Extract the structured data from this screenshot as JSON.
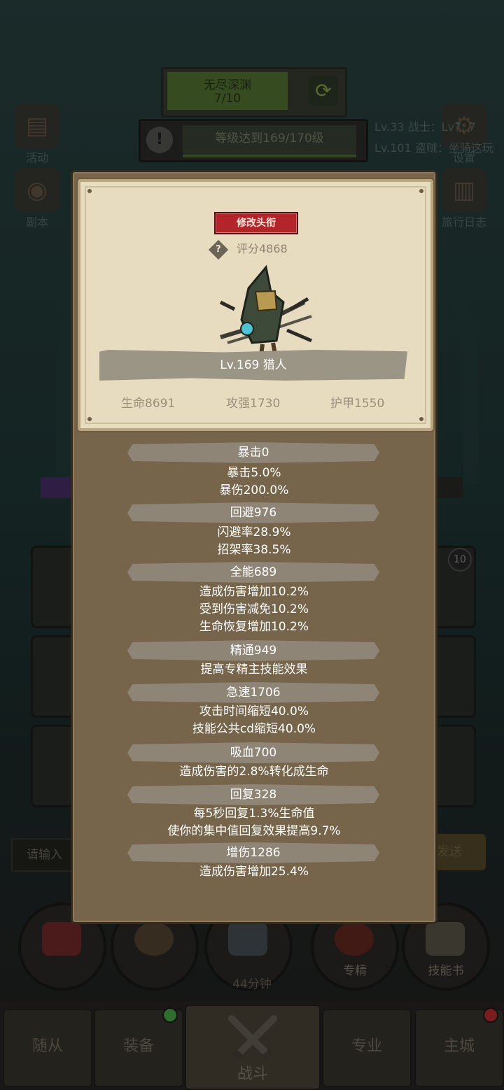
{
  "background": {
    "top_bar": {
      "title": "无尽深渊",
      "progress": "7/10",
      "cycle_icon": "refresh-icon"
    },
    "quest": {
      "text": "等级达到169/170级",
      "warn_icon": "!"
    },
    "left_buttons": [
      {
        "label": "活动"
      },
      {
        "label": "副本"
      }
    ],
    "right_buttons": [
      {
        "label": "设置"
      },
      {
        "label": "旅行日志"
      }
    ],
    "chat": [
      "Lv.33 战士：Lv7, 7",
      "Lv.101 盗贼：坐骑这玩"
    ],
    "badge": "10",
    "input_placeholder": "请输入",
    "send_label": "发送",
    "circles": [
      {
        "label": ""
      },
      {
        "label": ""
      },
      {
        "label": ""
      },
      {
        "label": "专精"
      },
      {
        "label": "技能书"
      }
    ],
    "timer": "44分钟",
    "nav": [
      {
        "label": "随从"
      },
      {
        "label": "装备"
      },
      {
        "label": "战斗"
      },
      {
        "label": "专业"
      },
      {
        "label": "主城"
      }
    ],
    "colors": {
      "green_dot": "#4cae4c",
      "red_dot": "#c62f2f"
    }
  },
  "modal": {
    "title_button": "修改头衔",
    "score": "评分4868",
    "score_icon": "?",
    "character": "Lv.169 猎人",
    "stats": {
      "hp": "生命8691",
      "atk": "攻强1730",
      "armor": "护甲1550"
    },
    "sections": [
      {
        "header": "暴击0",
        "lines": [
          "暴击5.0%",
          "暴伤200.0%"
        ]
      },
      {
        "header": "回避976",
        "lines": [
          "闪避率28.9%",
          "招架率38.5%"
        ]
      },
      {
        "header": "全能689",
        "lines": [
          "造成伤害增加10.2%",
          "受到伤害减免10.2%",
          "生命恢复增加10.2%"
        ]
      },
      {
        "header": "精通949",
        "lines": [
          "提高专精主技能效果"
        ]
      },
      {
        "header": "急速1706",
        "lines": [
          "攻击时间缩短40.0%",
          "技能公共cd缩短40.0%"
        ]
      },
      {
        "header": "吸血700",
        "lines": [
          "造成伤害的2.8%转化成生命"
        ]
      },
      {
        "header": "回复328",
        "lines": [
          "每5秒回复1.3%生命值",
          "使你的集中值回复效果提高9.7%"
        ]
      },
      {
        "header": "增伤1286",
        "lines": [
          "造成伤害增加25.4%"
        ]
      }
    ]
  }
}
